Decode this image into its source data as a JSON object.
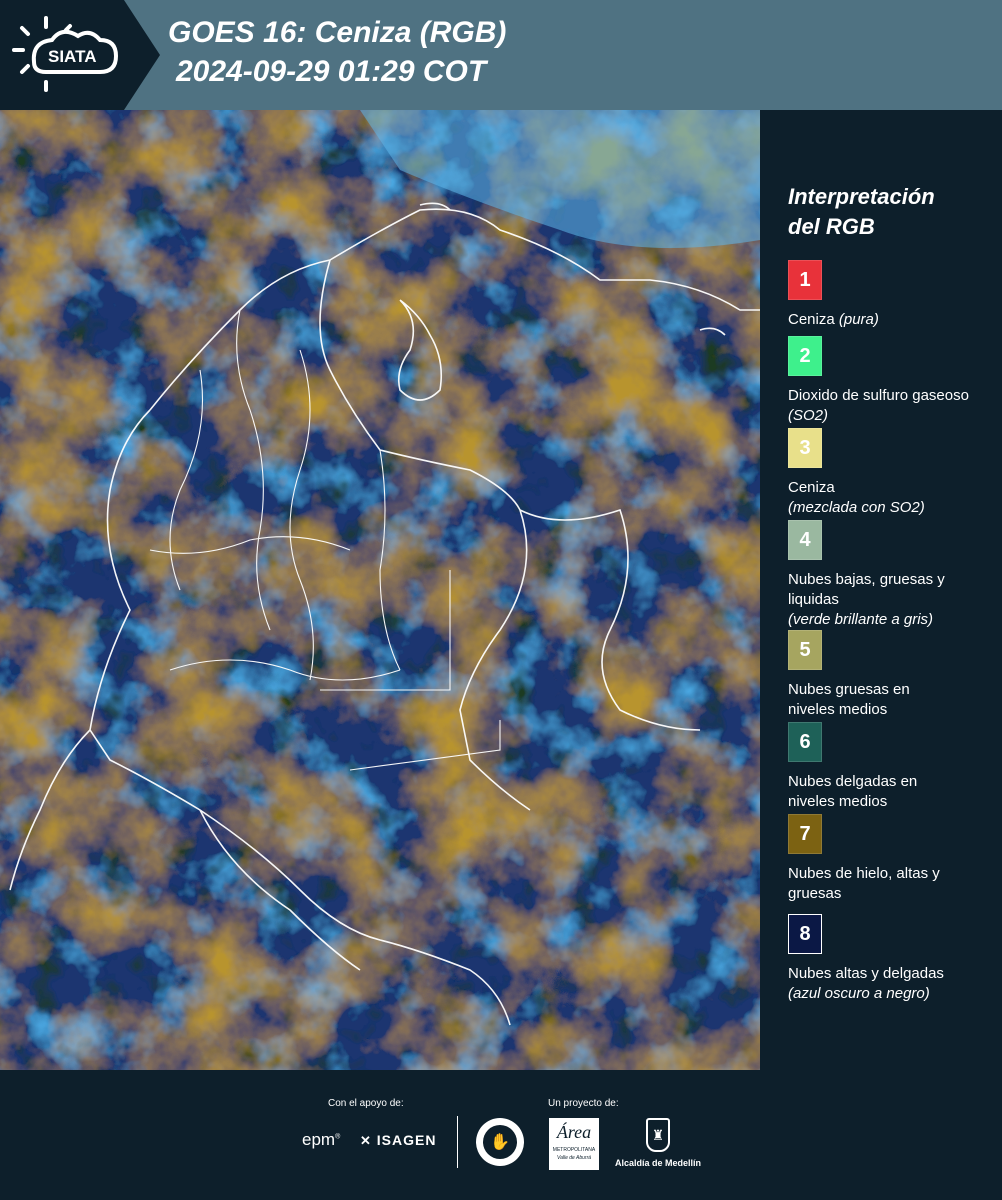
{
  "header": {
    "logo_text": "SIATA",
    "title": "GOES 16: Ceniza (RGB)",
    "datetime": "2024-09-29 01:29 COT"
  },
  "legend": {
    "title_line1": "Interpretación",
    "title_line2": "del RGB",
    "items": [
      {
        "num": "1",
        "color": "#e8323a",
        "text": "Ceniza",
        "note": "(pura)"
      },
      {
        "num": "2",
        "color": "#3ef08c",
        "text": "Dioxido de sulfuro gaseoso",
        "note": "(SO2)"
      },
      {
        "num": "3",
        "color": "#e8e08a",
        "text": "Ceniza",
        "note": "(mezclada con SO2)"
      },
      {
        "num": "4",
        "color": "#9ab8a0",
        "text": "Nubes bajas, gruesas y liquidas",
        "note": "(verde brillante a gris)"
      },
      {
        "num": "5",
        "color": "#a6a560",
        "text": "Nubes gruesas en niveles medios",
        "note": ""
      },
      {
        "num": "6",
        "color": "#1e6158",
        "text": "Nubes delgadas en niveles medios",
        "note": ""
      },
      {
        "num": "7",
        "color": "#7c6212",
        "text": "Nubes de hielo, altas y gruesas",
        "note": ""
      },
      {
        "num": "8",
        "color": "#0b1845",
        "text": "Nubes altas y delgadas",
        "note": "(azul oscuro a negro)"
      }
    ]
  },
  "footer": {
    "support_label": "Con el apoyo de:",
    "project_label": "Un proyecto de:",
    "logos": {
      "epm": "epm",
      "isagen": "ISAGEN",
      "area_main": "Área",
      "area_sub": "METROPOLITANA",
      "area_tag": "Valle de Aburrá",
      "alcaldia": "Alcaldía de Medellín"
    }
  }
}
